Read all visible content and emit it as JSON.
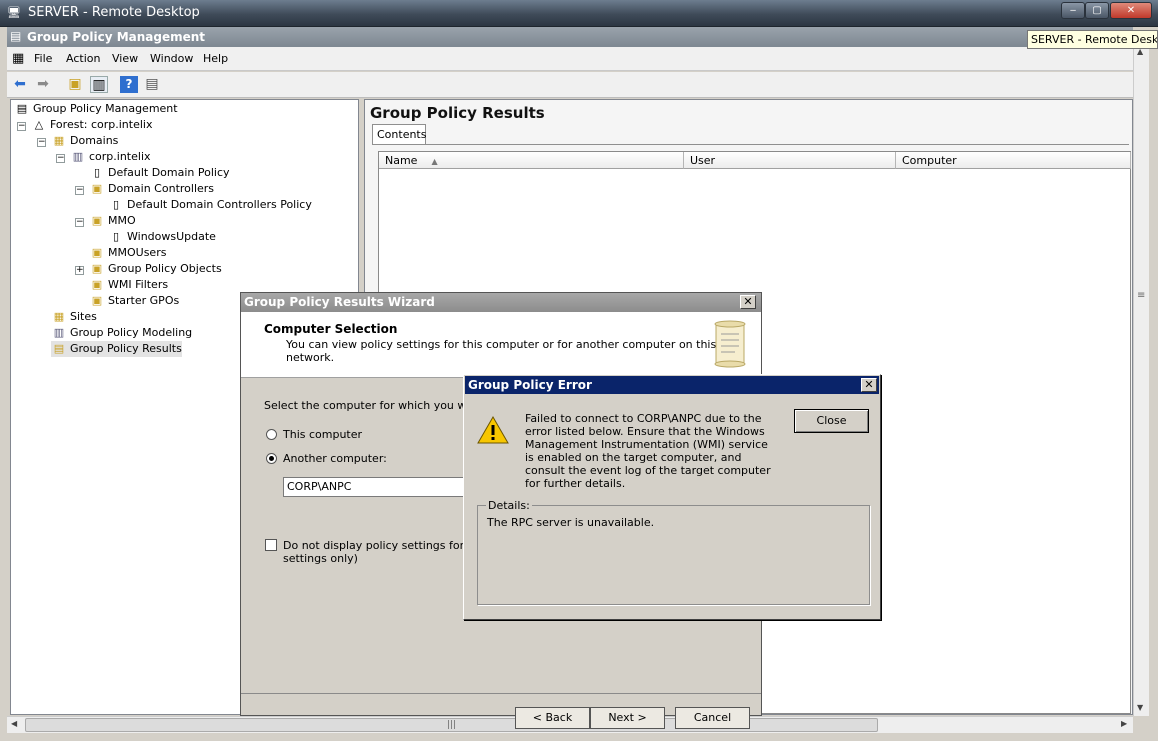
{
  "remote_desktop": {
    "title": "SERVER - Remote Desktop",
    "min": "_",
    "max": "□",
    "close": "x"
  },
  "tooltip": "SERVER - Remote Desktop",
  "app": {
    "title": "Group Policy Management"
  },
  "menu": [
    "File",
    "Action",
    "View",
    "Window",
    "Help"
  ],
  "tree": {
    "root": "Group Policy Management",
    "forest": "Forest: corp.intelix",
    "domains": "Domains",
    "domain": "corp.intelix",
    "default_domain_policy": "Default Domain Policy",
    "domain_controllers": "Domain Controllers",
    "default_dc_policy": "Default Domain Controllers Policy",
    "mmo": "MMO",
    "windows_update": "WindowsUpdate",
    "mmo_users": "MMOUsers",
    "gpo": "Group Policy Objects",
    "wmi": "WMI Filters",
    "starter": "Starter GPOs",
    "sites": "Sites",
    "modeling": "Group Policy Modeling",
    "results": "Group Policy Results"
  },
  "results_pane": {
    "title": "Group Policy Results",
    "tab": "Contents",
    "columns": [
      "Name",
      "User",
      "Computer"
    ]
  },
  "wizard": {
    "title": "Group Policy Results Wizard",
    "heading": "Computer Selection",
    "subheading": "You can view policy settings for this computer or for another computer on this network.",
    "prompt": "Select the computer for which you want to",
    "radio_this": "This computer",
    "radio_another": "Another computer:",
    "computer_value": "CORP\\ANPC",
    "checkbox_line1": "Do not display policy settings for the se",
    "checkbox_line2": "settings only)",
    "back_button": "< Back",
    "next_button": "Next >",
    "cancel_button": "Cancel",
    "selected": "another"
  },
  "error_dialog": {
    "title": "Group Policy Error",
    "message": "Failed to connect to CORP\\ANPC due to the error listed below. Ensure that the Windows Management Instrumentation (WMI) service is enabled on the target computer, and consult the event log of the target computer for further details.",
    "close_button": "Close",
    "details_label": "Details:",
    "details_text": "The RPC server is unavailable."
  },
  "colors": {
    "error_title_bar": "#0a246a",
    "dialog_face": "#d4d0c8"
  }
}
